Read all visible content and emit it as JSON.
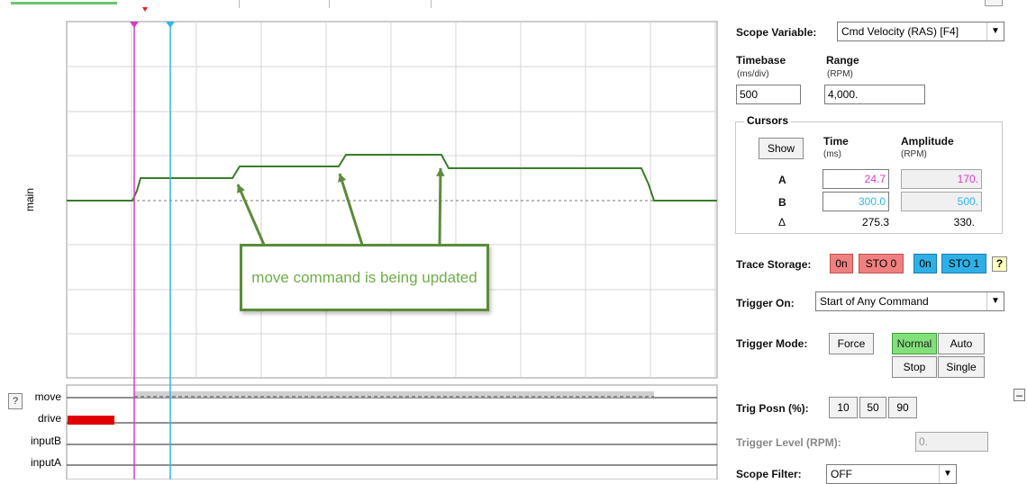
{
  "scope": {
    "main_label": "main",
    "digital_labels": [
      "move",
      "drive",
      "inputB",
      "inputA"
    ],
    "help_label": "?",
    "callout_text": "move command is being updated"
  },
  "panel": {
    "scope_variable_label": "Scope Variable:",
    "scope_variable_value": "Cmd Velocity (RAS) [F4]",
    "timebase_label": "Timebase",
    "timebase_unit": "(ms/div)",
    "timebase_value": "500",
    "range_label": "Range",
    "range_unit": "(RPM)",
    "range_value": "4,000.",
    "cursors": {
      "title": "Cursors",
      "show_button": "Show",
      "time_label": "Time",
      "time_unit": "(ms)",
      "amplitude_label": "Amplitude",
      "amplitude_unit": "(RPM)",
      "row_a": "A",
      "row_b": "B",
      "row_delta": "Δ",
      "a_time": "24.7",
      "a_amp": "170.",
      "b_time": "300.0",
      "b_amp": "500.",
      "delta_time": "275.3",
      "delta_amp": "330."
    },
    "trace_storage_label": "Trace Storage:",
    "sto0_on": "0n",
    "sto0": "STO 0",
    "sto1_on": "0n",
    "sto1": "STO 1",
    "help": "?",
    "trigger_on_label": "Trigger On:",
    "trigger_on_value": "Start of Any Command",
    "trigger_mode_label": "Trigger Mode:",
    "force": "Force",
    "normal": "Normal",
    "auto": "Auto",
    "stop": "Stop",
    "single": "Single",
    "trig_posn_label": "Trig Posn (%):",
    "posn_10": "10",
    "posn_50": "50",
    "posn_90": "90",
    "minus": "–",
    "trigger_level_label": "Trigger Level (RPM):",
    "trigger_level_value": "0.",
    "scope_filter_label": "Scope Filter:",
    "scope_filter_value": "OFF"
  },
  "colors": {
    "trace": "#3a7d2c",
    "cursor_a": "#d63cc8",
    "cursor_b": "#2fb5e8",
    "callout_border": "#5b8c39",
    "callout_text": "#70ad47",
    "drive_bar": "#e00000"
  }
}
